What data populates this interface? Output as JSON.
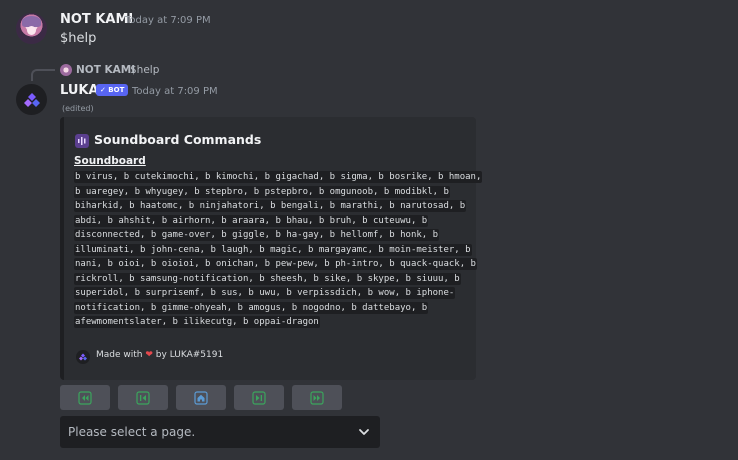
{
  "message1": {
    "author": "NOT KAMI",
    "timestamp": "Today at 7:09 PM",
    "content": "$help"
  },
  "reply": {
    "author": "NOT KAMI",
    "content": "$help"
  },
  "message2": {
    "author": "LUKA",
    "bot_badge": "✓ BOT",
    "timestamp": "Today at 7:09 PM",
    "edited": "(edited)"
  },
  "embed": {
    "title": "Soundboard Commands",
    "field_name": "Soundboard",
    "lines": [
      "b virus, b cutekimochi, b kimochi, b gigachad, b sigma, b bosrike, b hmoan,",
      "b uaregey, b whyugey, b stepbro, b pstepbro, b omgunoob, b modibkl, b",
      "biharkid, b haatomc, b ninjahatori, b bengali, b marathi, b narutosad, b",
      "abdi, b ahshit, b airhorn, b araara, b bhau, b bruh, b cuteuwu, b",
      "disconnected, b game-over, b giggle, b ha-gay, b hellomf, b honk, b",
      "illuminati, b john-cena, b laugh, b magic, b margayamc, b moin-meister, b",
      "nani, b oioi, b oioioi, b onichan, b pew-pew, b ph-intro, b quack-quack, b",
      "rickroll, b samsung-notification, b sheesh, b sike, b skype, b siuuu, b",
      "superidol, b surprisemf, b sus, b uwu, b verpissdich, b wow, b iphone-",
      "notification, b gimme-ohyeah, b amogus, b nogodno, b dattebayo, b",
      "afewmomentslater, b ilikecutg, b oppai-dragon"
    ],
    "footer_prefix": "Made with",
    "footer_heart": "❤",
    "footer_suffix": "by LUKA#5191"
  },
  "buttons": [
    {
      "name": "first-page-button",
      "icon": "double-arrow-left-icon"
    },
    {
      "name": "previous-page-button",
      "icon": "arrow-left-bar-icon"
    },
    {
      "name": "home-button",
      "icon": "home-icon"
    },
    {
      "name": "next-page-button",
      "icon": "arrow-right-bar-icon"
    },
    {
      "name": "last-page-button",
      "icon": "double-arrow-right-icon"
    }
  ],
  "select": {
    "placeholder": "Please select a page."
  },
  "colors": {
    "background": "#313338",
    "embed_bg": "#2b2d31",
    "button_bg": "#4e5058",
    "button_icon": "#3ba55d",
    "bot_badge": "#5865f2"
  }
}
